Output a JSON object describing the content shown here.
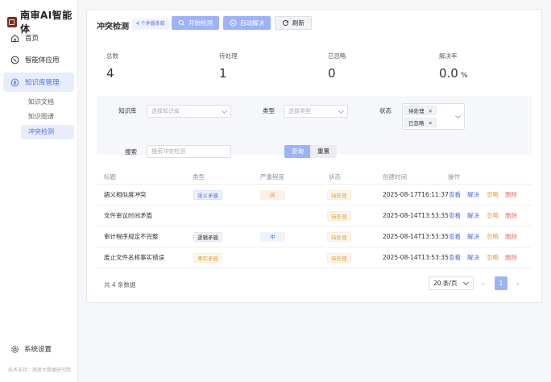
{
  "app": {
    "name": "南审AI智能体",
    "footer": "技术支持：南审大数据研究院"
  },
  "sidebar": {
    "items": [
      {
        "label": "首页",
        "icon": "home-icon"
      },
      {
        "label": "智能体应用",
        "icon": "compass-icon"
      },
      {
        "label": "知识库管理",
        "icon": "database-icon"
      }
    ],
    "subitems": [
      {
        "label": "知识文档"
      },
      {
        "label": "知识图谱"
      },
      {
        "label": "冲突检测"
      }
    ],
    "settings_label": "系统设置"
  },
  "header": {
    "title": "冲突检测",
    "badge": "4 个矛盾条款",
    "start_btn": "开始检测",
    "auto_btn": "自动解决",
    "refresh_btn": "刷新"
  },
  "stats": [
    {
      "label": "总数",
      "value": "4"
    },
    {
      "label": "待处理",
      "value": "1"
    },
    {
      "label": "已忽略",
      "value": "0"
    },
    {
      "label": "解决率",
      "value": "0.0",
      "unit": "%"
    }
  ],
  "filters": {
    "kb_label": "知识库",
    "kb_placeholder": "选择知识库",
    "type_label": "类型",
    "type_placeholder": "选择类型",
    "status_label": "状态",
    "status_tags": [
      "待处理",
      "已忽略"
    ],
    "search_label": "搜索",
    "search_placeholder": "搜索冲突检测",
    "query_btn": "查询",
    "reset_btn": "重置"
  },
  "table": {
    "headers": [
      "标题",
      "类型",
      "严重程度",
      "状态",
      "创建时间",
      "操作"
    ],
    "rows": [
      {
        "title": "語义相似度冲突",
        "type": "語义矛盾",
        "severity": "高",
        "status": "待处理",
        "time": "2025-08-17T16:11:37"
      },
      {
        "title": "文件审议时间矛盾",
        "type": "",
        "severity": "",
        "status": "待处理",
        "time": "2025-08-14T13:53:35"
      },
      {
        "title": "审计程序规定不完整",
        "type": "逻辑矛盾",
        "severity": "中",
        "status": "待处理",
        "time": "2025-08-14T13:53:35"
      },
      {
        "title": "废止文件名称事实错误",
        "type": "事实矛盾",
        "severity": "",
        "status": "待处理",
        "time": "2025-08-14T13:53:35"
      }
    ],
    "actions": [
      "查看",
      "解决",
      "忽略",
      "删除"
    ]
  },
  "pagination": {
    "total_text": "共 4 条数据",
    "page_size": "20 条/页",
    "current_page": "1",
    "prev": "‹",
    "next": "›"
  }
}
